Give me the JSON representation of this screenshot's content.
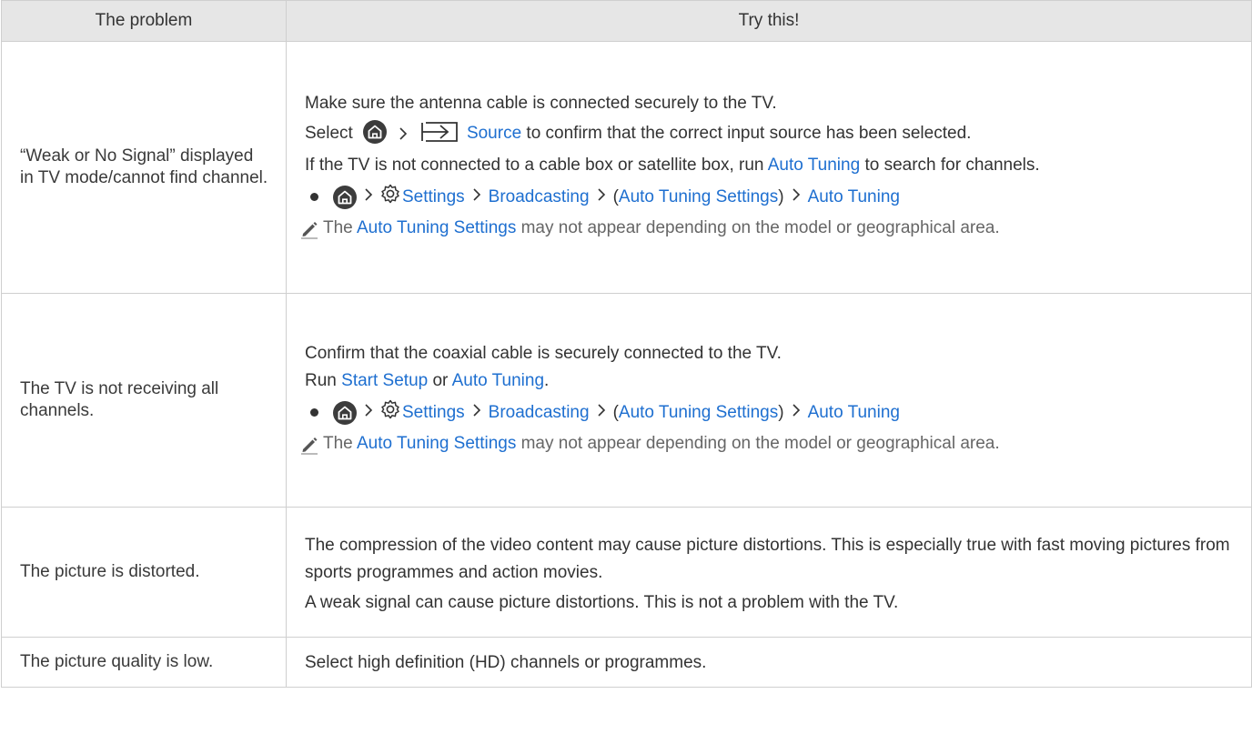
{
  "header": {
    "col1": "The problem",
    "col2": "Try this!"
  },
  "rows": [
    {
      "problem": "“Weak or No Signal” displayed in TV mode/cannot find channel.",
      "line1": "Make sure the antenna cable is connected securely to the TV.",
      "line2_pre": "Select",
      "line2_link": "Source",
      "line2_post": "to confirm that the correct input source has been selected.",
      "line3_pre": "If the TV is not connected to a cable box or satellite box, run",
      "line3_link": "Auto Tuning",
      "line3_post": "to search for channels.",
      "path": {
        "settings": "Settings",
        "broadcasting": "Broadcasting",
        "open": "(",
        "ats": "Auto Tuning Settings",
        "close": ")",
        "at": "Auto Tuning"
      },
      "note_pre": "The",
      "note_link": "Auto Tuning Settings",
      "note_post": "may not appear depending on the model or geographical area."
    },
    {
      "problem": "The TV is not receiving all channels.",
      "line1": "Confirm that the coaxial cable is securely connected to the TV.",
      "line2_pre": "Run",
      "line2_link1": "Start Setup",
      "line2_mid": "or",
      "line2_link2": "Auto Tuning",
      "line2_post": ".",
      "path": {
        "settings": "Settings",
        "broadcasting": "Broadcasting",
        "open": "(",
        "ats": "Auto Tuning Settings",
        "close": ")",
        "at": "Auto Tuning"
      },
      "note_pre": "The",
      "note_link": "Auto Tuning Settings",
      "note_post": "may not appear depending on the model or geographical area."
    },
    {
      "problem": "The picture is distorted.",
      "line1": "The compression of the video content may cause picture distortions. This is especially true with fast moving pictures from sports programmes and action movies.",
      "line2": "A weak signal can cause picture distortions. This is not a problem with the TV."
    },
    {
      "problem": "The picture quality is low.",
      "line1": "Select high definition (HD) channels or programmes."
    }
  ],
  "colors": {
    "link": "#1e6fd0",
    "header_bg": "#e6e6e6",
    "border": "#cfcfcf"
  }
}
